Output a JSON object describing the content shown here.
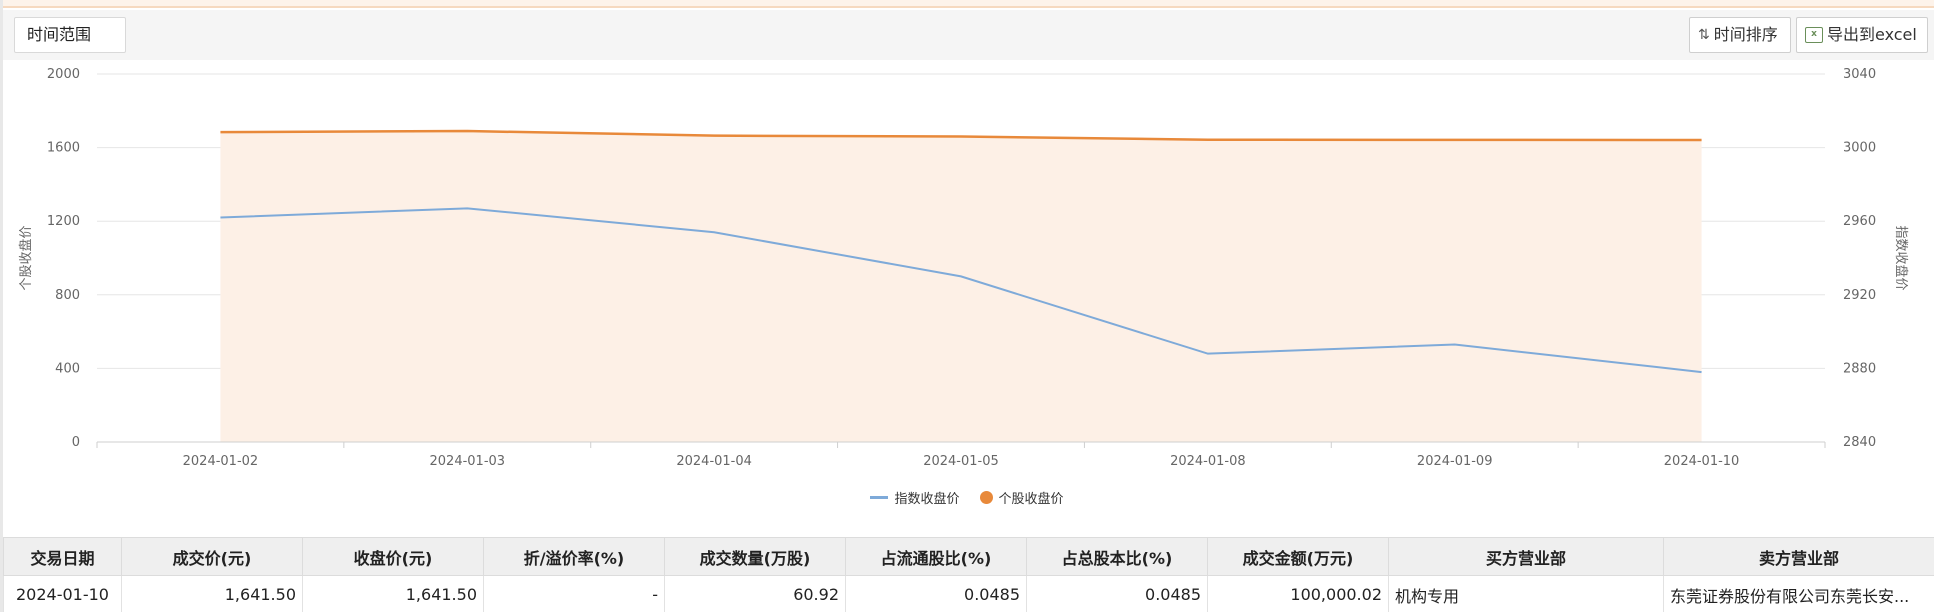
{
  "toolbar": {
    "range_label": "时间范围",
    "sort_label": "时间排序",
    "export_label": "导出到excel"
  },
  "colors": {
    "index_line": "#7eaad9",
    "stock_line": "#e8893a",
    "stock_area": "#fdf0e6"
  },
  "chart_data": {
    "type": "line",
    "categories": [
      "2024-01-02",
      "2024-01-03",
      "2024-01-04",
      "2024-01-05",
      "2024-01-08",
      "2024-01-09",
      "2024-01-10"
    ],
    "series": [
      {
        "name": "指数收盘价",
        "axis": "right",
        "values": [
          2962,
          2967,
          2954,
          2930,
          2888,
          2893,
          2878
        ]
      },
      {
        "name": "个股收盘价",
        "axis": "left",
        "values": [
          1684,
          1690,
          1665,
          1660,
          1643,
          1642,
          1641.5
        ]
      }
    ],
    "ylabel_left": "个股收盘价",
    "ylabel_right": "指数收盘价",
    "ylim_left": [
      0,
      2000
    ],
    "yticks_left": [
      "0",
      "400",
      "800",
      "1200",
      "1600",
      "2000"
    ],
    "ylim_right": [
      2840,
      3040
    ],
    "yticks_right": [
      "2840",
      "2880",
      "2920",
      "2960",
      "3000",
      "3040"
    ],
    "grid": true,
    "legend": "bottom-center"
  },
  "table": {
    "headers": [
      "交易日期",
      "成交价(元)",
      "收盘价(元)",
      "折/溢价率(%)",
      "成交数量(万股)",
      "占流通股比(%)",
      "占总股本比(%)",
      "成交金额(万元)",
      "买方营业部",
      "卖方营业部"
    ],
    "rows": [
      [
        "2024-01-10",
        "1,641.50",
        "1,641.50",
        "-",
        "60.92",
        "0.0485",
        "0.0485",
        "100,000.02",
        "机构专用",
        "东莞证券股份有限公司东莞长安..."
      ]
    ]
  }
}
